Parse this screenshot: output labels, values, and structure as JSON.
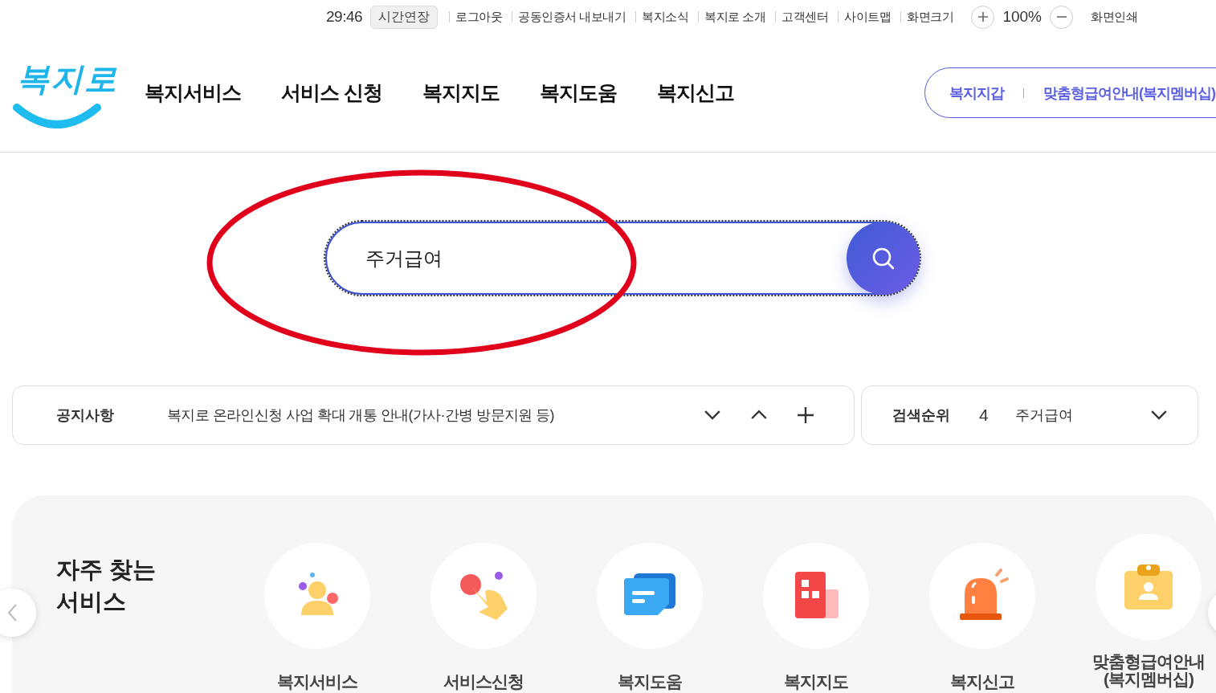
{
  "top_bar": {
    "timer": "29:46",
    "extend_button": "시간연장",
    "links": [
      "로그아웃",
      "공동인증서 내보내기",
      "복지소식",
      "복지로 소개",
      "고객센터",
      "사이트맵",
      "화면크기"
    ],
    "zoom_value": "100%",
    "print_link": "화면인쇄"
  },
  "header": {
    "logo": "복지로",
    "nav": [
      "복지서비스",
      "서비스 신청",
      "복지지도",
      "복지도움",
      "복지신고"
    ],
    "quick_links": [
      "복지지갑",
      "맞춤형급여안내(복지멤버십)"
    ]
  },
  "search": {
    "value": "주거급여"
  },
  "annotation": {
    "kind": "ellipse"
  },
  "notice": {
    "label": "공지사항",
    "text": "복지로 온라인신청 사업 확대 개통 안내(가사·간병 방문지원 등)"
  },
  "ranking": {
    "label": "검색순위",
    "rank": "4",
    "keyword": "주거급여"
  },
  "frequent_services": {
    "title": "자주 찾는 서비스",
    "items": [
      {
        "label": "복지서비스",
        "kind": "person"
      },
      {
        "label": "서비스신청",
        "kind": "hand"
      },
      {
        "label": "복지도움",
        "kind": "chat"
      },
      {
        "label": "복지지도",
        "kind": "building"
      },
      {
        "label": "복지신고",
        "kind": "siren"
      },
      {
        "label": "맞춤형급여안내(복지멤버십)",
        "kind": "clipboard"
      }
    ]
  }
}
